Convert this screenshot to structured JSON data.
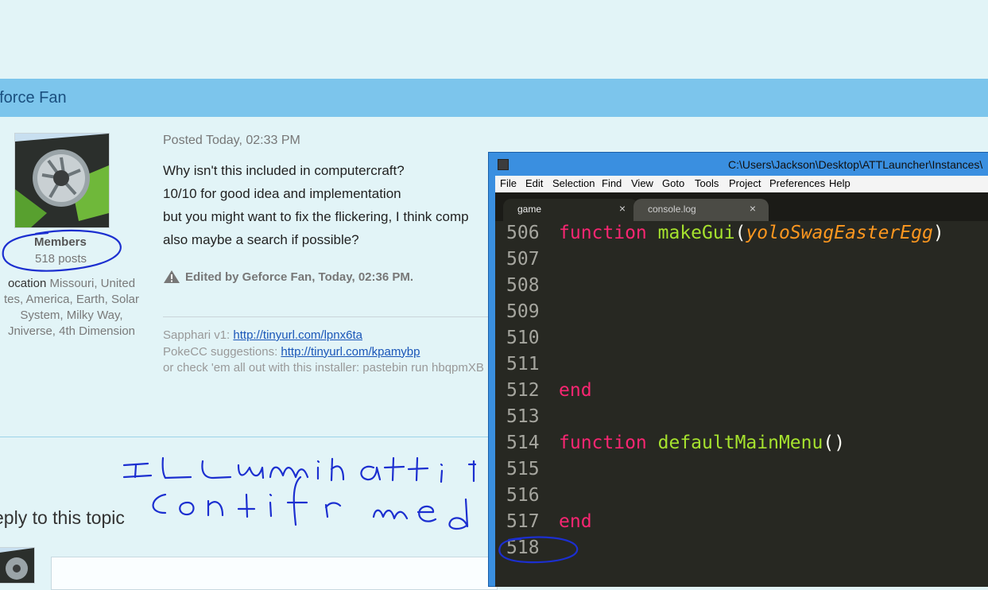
{
  "topic_header": {
    "title": "eforce Fan"
  },
  "post": {
    "author": {
      "group": "Members",
      "posts": "518 posts",
      "location_label": "ocation",
      "location_lines": [
        "Missouri, United",
        "tes, America, Earth, Solar",
        "System, Milky Way,",
        "Jniverse, 4th Dimension"
      ]
    },
    "posted_time": "Posted Today, 02:33 PM",
    "body_lines": [
      "Why isn't this included in computercraft?",
      "10/10 for good idea and implementation",
      "but you might want to fix the flickering, I think comp",
      "also maybe a search if possible?"
    ],
    "edited_note": "Edited by Geforce Fan, Today, 02:36 PM.",
    "signature": {
      "line1_prefix": "Sapphari v1: ",
      "line1_link": "http://tinyurl.com/lpnx6ta",
      "line2_prefix": "PokeCC suggestions: ",
      "line2_link": "http://tinyurl.com/kpamybp",
      "line3": "or check 'em all out with this installer: pastebin run hbqpmXB"
    }
  },
  "reply_section": {
    "title": "eply to this topic"
  },
  "editor": {
    "title": "C:\\Users\\Jackson\\Desktop\\ATTLauncher\\Instances\\",
    "menu": [
      "File",
      "Edit",
      "Selection",
      "Find",
      "View",
      "Goto",
      "Tools",
      "Project",
      "Preferences",
      "Help"
    ],
    "tabs": [
      {
        "label": "game",
        "close": "×"
      },
      {
        "label": "console.log",
        "close": "×"
      }
    ],
    "lines": [
      {
        "num": "506",
        "kw": "function",
        "fn": "makeGui",
        "open": "(",
        "arg": "yoloSwagEasterEgg",
        "close": ")"
      },
      {
        "num": "507"
      },
      {
        "num": "508"
      },
      {
        "num": "509"
      },
      {
        "num": "510"
      },
      {
        "num": "511"
      },
      {
        "num": "512",
        "kw": "end"
      },
      {
        "num": "513"
      },
      {
        "num": "514",
        "kw": "function",
        "fn": "defaultMainMenu",
        "open": "(",
        "close": ")"
      },
      {
        "num": "515"
      },
      {
        "num": "516"
      },
      {
        "num": "517",
        "kw": "end"
      },
      {
        "num": "518"
      }
    ]
  },
  "colors": {
    "header_bar": "#7cc5ec",
    "page_bg": "#e2f4f7",
    "editor_bg": "#272822",
    "keyword": "#f92672",
    "function": "#a6e22e",
    "argument": "#fd971f",
    "annotation_ink": "#1c2fd0"
  }
}
